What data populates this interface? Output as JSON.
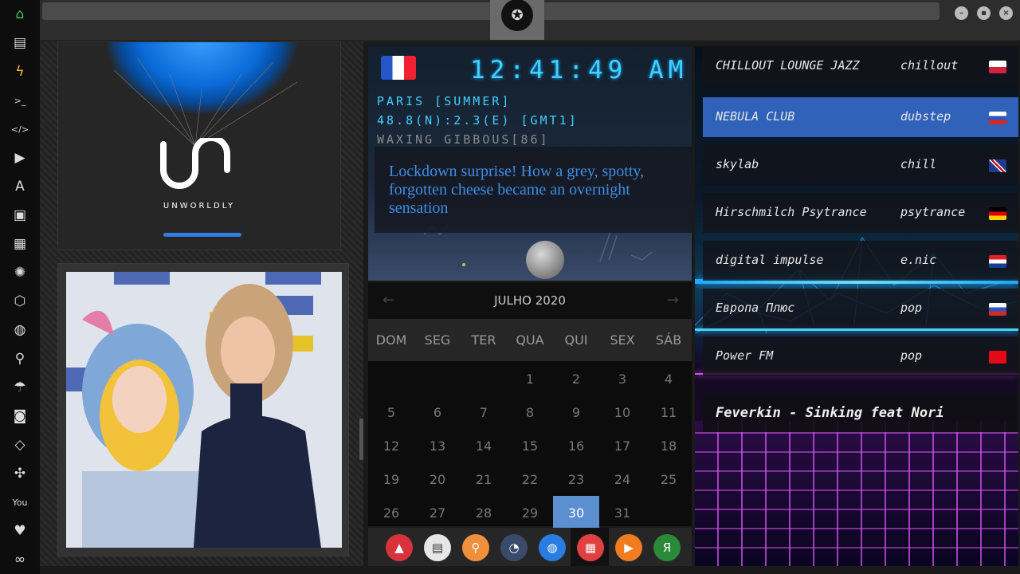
{
  "sidebar": {
    "items": [
      {
        "icon": "home-icon",
        "glyph": "⌂"
      },
      {
        "icon": "document-icon",
        "glyph": "▤"
      },
      {
        "icon": "bolt-icon",
        "glyph": "ϟ"
      },
      {
        "icon": "terminal-icon",
        "glyph": ">_"
      },
      {
        "icon": "code-icon",
        "glyph": "</>"
      },
      {
        "icon": "play-icon",
        "glyph": "▶"
      },
      {
        "icon": "translate-icon",
        "glyph": "A"
      },
      {
        "icon": "image-icon",
        "glyph": "▣"
      },
      {
        "icon": "news-icon",
        "glyph": "▦"
      },
      {
        "icon": "aperture-icon",
        "glyph": "✺"
      },
      {
        "icon": "hexagon-icon",
        "glyph": "⬡"
      },
      {
        "icon": "globe-icon",
        "glyph": "◍"
      },
      {
        "icon": "search-icon",
        "glyph": "⚲"
      },
      {
        "icon": "umbrella-icon",
        "glyph": "☂"
      },
      {
        "icon": "contact-icon",
        "glyph": "◙"
      },
      {
        "icon": "diamond-code-icon",
        "glyph": "◇"
      },
      {
        "icon": "expand-icon",
        "glyph": "✣"
      },
      {
        "icon": "youtube-icon",
        "glyph": "You"
      },
      {
        "icon": "heart-icon",
        "glyph": "♥"
      },
      {
        "icon": "infinity-icon",
        "glyph": "∞"
      }
    ]
  },
  "left": {
    "brand_text": "UNWORLDLY"
  },
  "clock": {
    "time": "12:41:49",
    "ampm": "AM",
    "location": "PARIS [SUMMER]",
    "coords": "48.8(N):2.3(E) [GMT1]",
    "moon_phase": "WAXING GIBBOUS[86]",
    "headline": "Lockdown surprise! How a grey, spotty, forgotten cheese became an overnight sensation"
  },
  "calendar": {
    "month_label": "JULHO 2020",
    "prev": "←",
    "next": "→",
    "weekdays": [
      "DOM",
      "SEG",
      "TER",
      "QUA",
      "QUI",
      "SEX",
      "SÁB"
    ],
    "weeks": [
      [
        "",
        "",
        "",
        "1",
        "2",
        "3",
        "4"
      ],
      [
        "5",
        "6",
        "7",
        "8",
        "9",
        "10",
        "11"
      ],
      [
        "12",
        "13",
        "14",
        "15",
        "16",
        "17",
        "18"
      ],
      [
        "19",
        "20",
        "21",
        "22",
        "23",
        "24",
        "25"
      ],
      [
        "26",
        "27",
        "28",
        "29",
        "30",
        "31",
        ""
      ]
    ],
    "today": "30"
  },
  "dock": {
    "items": [
      {
        "name": "dock-app-vivaldi-icon",
        "glyph": "▲",
        "color": "#d6333a"
      },
      {
        "name": "dock-app-news-icon",
        "glyph": "▤",
        "color": "#e6e6e6"
      },
      {
        "name": "dock-app-search-icon",
        "glyph": "⚲",
        "color": "#f0903c"
      },
      {
        "name": "dock-app-clock-icon",
        "glyph": "◔",
        "color": "#3a4a6a"
      },
      {
        "name": "dock-app-globe-icon",
        "glyph": "◍",
        "color": "#2a7de0"
      },
      {
        "name": "dock-app-calendar-icon",
        "glyph": "▦",
        "color": "#e04040"
      },
      {
        "name": "dock-app-player-icon",
        "glyph": "▶",
        "color": "#ef7d20"
      },
      {
        "name": "dock-app-yandex-icon",
        "glyph": "Я",
        "color": "#2a8a3a"
      }
    ]
  },
  "radio": {
    "stations": [
      {
        "name": "CHILLOUT LOUNGE JAZZ",
        "genre": "chillout",
        "flag": "poland-flag-icon",
        "active": false
      },
      {
        "name": "NEBULA CLUB",
        "genre": "dubstep",
        "flag": "russia-flag-icon",
        "active": true
      },
      {
        "name": "skylab",
        "genre": "chill",
        "flag": "uk-flag-icon",
        "active": false
      },
      {
        "name": "Hirschmilch Psytrance",
        "genre": "psytrance",
        "flag": "germany-flag-icon",
        "active": false
      },
      {
        "name": "digital impulse",
        "genre": "e.nic",
        "flag": "croatia-flag-icon",
        "active": false
      },
      {
        "name": "Европа Плюс",
        "genre": "pop",
        "flag": "russia-flag-icon",
        "active": false
      },
      {
        "name": "Power FM",
        "genre": "pop",
        "flag": "turkey-flag-icon",
        "active": false
      }
    ],
    "now_playing": "Feverkin - Sinking feat Nori"
  },
  "colors": {
    "accent_blue": "#2f62b8",
    "clock_cyan": "#41d0ff",
    "clock_orange": "#f6a623",
    "today_blue": "#5b8fd0",
    "headline_blue": "#3d8ee6"
  }
}
